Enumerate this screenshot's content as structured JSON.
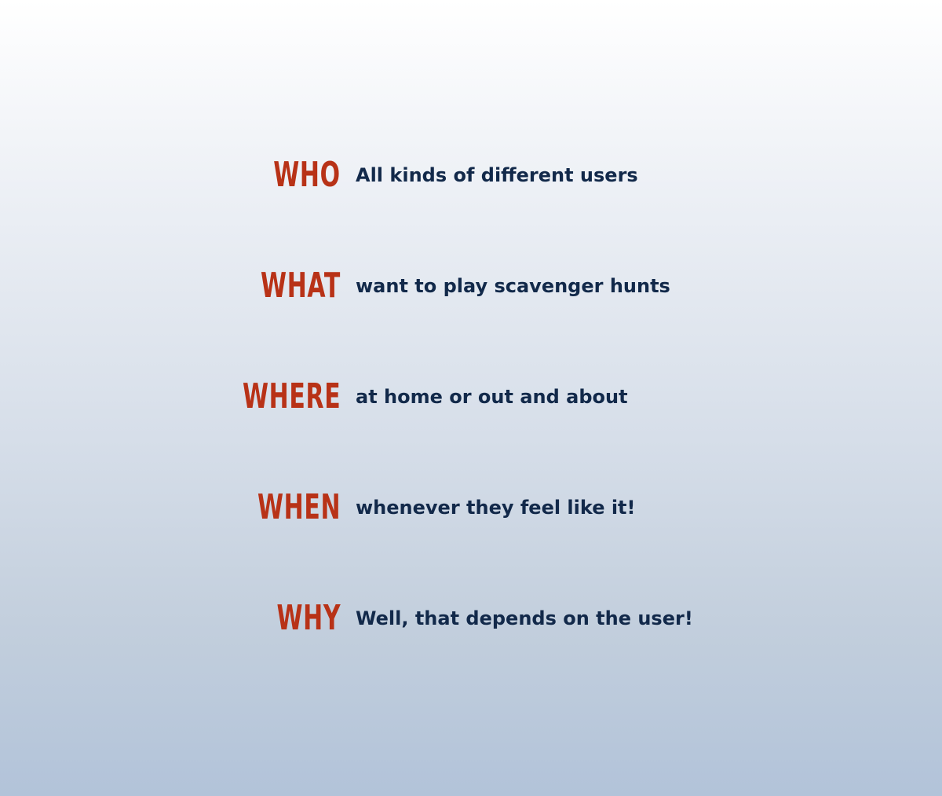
{
  "colors": {
    "keyword": "#b83217",
    "answer": "#12294a",
    "background_top": "#ffffff",
    "background_bottom": "#b2c3d9"
  },
  "rows": [
    {
      "keyword": "WHO",
      "answer": "All kinds of different users"
    },
    {
      "keyword": "WHAT",
      "answer": "want to play scavenger hunts"
    },
    {
      "keyword": "WHERE",
      "answer": "at home or out and about"
    },
    {
      "keyword": "WHEN",
      "answer": "whenever they feel like it!"
    },
    {
      "keyword": "WHY",
      "answer": "Well, that depends on the user!"
    }
  ]
}
